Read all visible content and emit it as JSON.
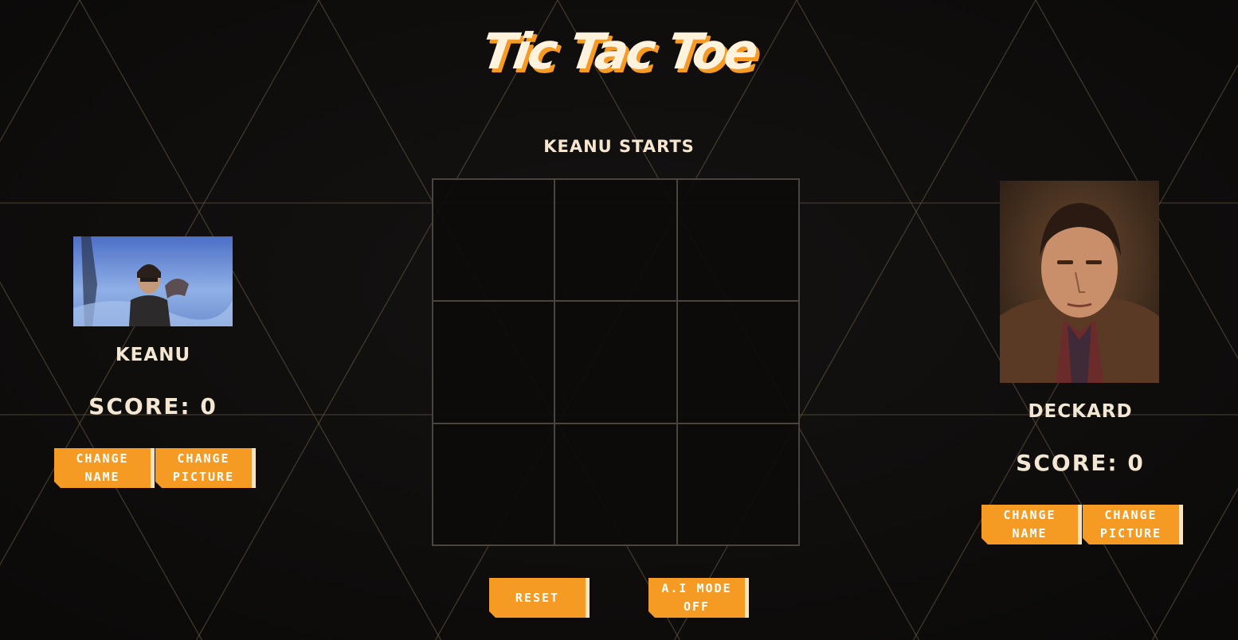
{
  "title": "Tic Tac Toe",
  "status": "Keanu starts",
  "board": {
    "cells": [
      "",
      "",
      "",
      "",
      "",
      "",
      "",
      "",
      ""
    ]
  },
  "player1": {
    "name": "Keanu",
    "score": "Score: 0",
    "change_name_label": "Change\nName",
    "change_picture_label": "Change\nPicture"
  },
  "player2": {
    "name": "Deckard",
    "score": "Score: 0",
    "change_name_label": "Change\nName",
    "change_picture_label": "Change\nPicture"
  },
  "controls": {
    "reset_label": "Reset",
    "ai_mode_label": "A.I Mode\nOff"
  },
  "colors": {
    "accent": "#f59a22",
    "background": "#0f0e0d",
    "text": "#f3e6d3",
    "grid_line": "#4a443c",
    "pattern_line": "#6b5b45"
  }
}
